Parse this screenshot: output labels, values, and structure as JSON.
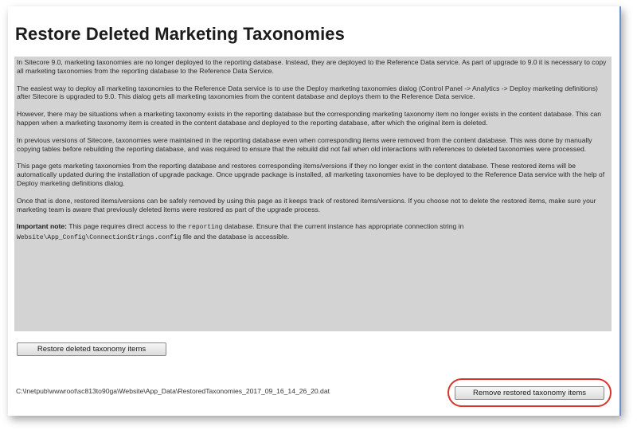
{
  "page": {
    "title": "Restore Deleted Marketing Taxonomies"
  },
  "info": {
    "paragraphs": [
      "In Sitecore 9.0, marketing taxonomies are no longer deployed to the reporting database. Instead, they are deployed to the Reference Data service. As part of upgrade to 9.0 it is necessary to copy all marketing taxonomies from the reporting database to the Reference Data Service.",
      "The easiest way to deploy all marketing taxonomies to the Reference Data service is to use the Deploy marketing taxonomies dialog (Control Panel -> Analytics -> Deploy marketing definitions) after Sitecore is upgraded to 9.0. This dialog gets all marketing taxonomies from the content database and deploys them to the Reference Data service.",
      "However, there may be situations when a marketing taxonomy exists in the reporting database but the corresponding marketing taxonomy item no longer exists in the content database. This can happen when a marketing taxonomy item is created in the content database and deployed to the reporting database, after which the original item is deleted.",
      "In previous versions of Sitecore, taxonomies were maintained in the reporting database even when corresponding items were removed from the content database. This was done by manually copying tables before rebuilding the reporting database, and was required to ensure that the rebuild did not fail when old interactions with references to deleted taxonomies were processed.",
      "This page gets marketing taxonomies from the reporting database and restores corresponding items/versions if they no longer exist in the content database. These restored items will be automatically updated during the installation of upgrade package. Once upgrade package is installed, all marketing taxonomies have to be deployed to the Reference Data service with the help of Deploy marketing definitions dialog.",
      "Once that is done, restored items/versions can be safely removed by using this page as it keeps track of restored items/versions. If you choose not to delete the restored items, make sure your marketing team is aware that previously deleted items were restored as part of the upgrade process."
    ],
    "note": {
      "label": "Important note:",
      "text_1": " This page requires direct access to the ",
      "code_1": "reporting",
      "text_2": " database. Ensure that the current instance has appropriate connection string in ",
      "code_2": "Website\\App_Config\\ConnectionStrings.config",
      "text_3": " file and the database is accessible."
    }
  },
  "buttons": {
    "restore_label": "Restore deleted taxonomy items",
    "remove_label": "Remove restored taxonomy items"
  },
  "file_path": "C:\\Inetpub\\wwwroot\\sc813to90ga\\Website\\App_Data\\RestoredTaxonomies_2017_09_16_14_26_20.dat",
  "colors": {
    "info_background": "#d3d3d3",
    "highlight_ring": "#d9342b",
    "accent_border": "#6e8fc5"
  }
}
